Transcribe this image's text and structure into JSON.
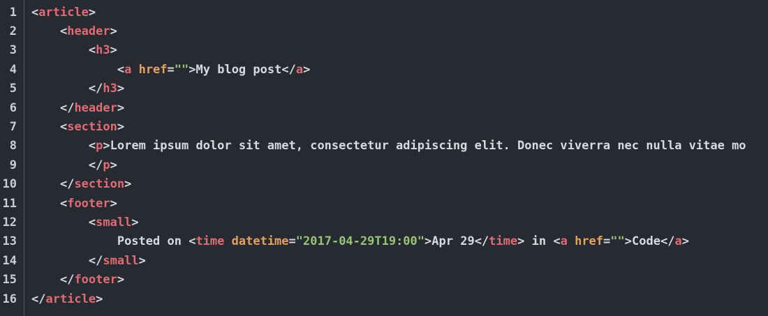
{
  "editor": {
    "colors": {
      "background": "#272a31",
      "tag": "#e06c75",
      "attribute": "#e5a25d",
      "string": "#98c379",
      "text": "#d7dae0",
      "line_number": "#c9ced6"
    },
    "lines": [
      {
        "number": "1",
        "indent": "",
        "tokens": [
          {
            "t": "p",
            "v": "<"
          },
          {
            "t": "tag",
            "v": "article"
          },
          {
            "t": "p",
            "v": ">"
          }
        ]
      },
      {
        "number": "2",
        "indent": "    ",
        "tokens": [
          {
            "t": "p",
            "v": "<"
          },
          {
            "t": "tag",
            "v": "header"
          },
          {
            "t": "p",
            "v": ">"
          }
        ]
      },
      {
        "number": "3",
        "indent": "        ",
        "tokens": [
          {
            "t": "p",
            "v": "<"
          },
          {
            "t": "tag",
            "v": "h3"
          },
          {
            "t": "p",
            "v": ">"
          }
        ]
      },
      {
        "number": "4",
        "indent": "            ",
        "tokens": [
          {
            "t": "p",
            "v": "<"
          },
          {
            "t": "tag",
            "v": "a"
          },
          {
            "t": "p",
            "v": " "
          },
          {
            "t": "attr",
            "v": "href"
          },
          {
            "t": "p",
            "v": "="
          },
          {
            "t": "str",
            "v": "\"\""
          },
          {
            "t": "p",
            "v": ">"
          },
          {
            "t": "txt",
            "v": "My blog post"
          },
          {
            "t": "p",
            "v": "</"
          },
          {
            "t": "tag",
            "v": "a"
          },
          {
            "t": "p",
            "v": ">"
          }
        ]
      },
      {
        "number": "5",
        "indent": "        ",
        "tokens": [
          {
            "t": "p",
            "v": "</"
          },
          {
            "t": "tag",
            "v": "h3"
          },
          {
            "t": "p",
            "v": ">"
          }
        ]
      },
      {
        "number": "6",
        "indent": "    ",
        "tokens": [
          {
            "t": "p",
            "v": "</"
          },
          {
            "t": "tag",
            "v": "header"
          },
          {
            "t": "p",
            "v": ">"
          }
        ]
      },
      {
        "number": "7",
        "indent": "    ",
        "tokens": [
          {
            "t": "p",
            "v": "<"
          },
          {
            "t": "tag",
            "v": "section"
          },
          {
            "t": "p",
            "v": ">"
          }
        ]
      },
      {
        "number": "8",
        "indent": "        ",
        "tokens": [
          {
            "t": "p",
            "v": "<"
          },
          {
            "t": "tag",
            "v": "p"
          },
          {
            "t": "p",
            "v": ">"
          },
          {
            "t": "txt",
            "v": "Lorem ipsum dolor sit amet, consectetur adipiscing elit. Donec viverra nec nulla vitae mo"
          }
        ]
      },
      {
        "number": "9",
        "indent": "        ",
        "tokens": [
          {
            "t": "p",
            "v": "</"
          },
          {
            "t": "tag",
            "v": "p"
          },
          {
            "t": "p",
            "v": ">"
          }
        ]
      },
      {
        "number": "10",
        "indent": "    ",
        "tokens": [
          {
            "t": "p",
            "v": "</"
          },
          {
            "t": "tag",
            "v": "section"
          },
          {
            "t": "p",
            "v": ">"
          }
        ]
      },
      {
        "number": "11",
        "indent": "    ",
        "tokens": [
          {
            "t": "p",
            "v": "<"
          },
          {
            "t": "tag",
            "v": "footer"
          },
          {
            "t": "p",
            "v": ">"
          }
        ]
      },
      {
        "number": "12",
        "indent": "        ",
        "tokens": [
          {
            "t": "p",
            "v": "<"
          },
          {
            "t": "tag",
            "v": "small"
          },
          {
            "t": "p",
            "v": ">"
          }
        ]
      },
      {
        "number": "13",
        "indent": "            ",
        "tokens": [
          {
            "t": "txt",
            "v": "Posted on "
          },
          {
            "t": "p",
            "v": "<"
          },
          {
            "t": "tag",
            "v": "time"
          },
          {
            "t": "p",
            "v": " "
          },
          {
            "t": "attr",
            "v": "datetime"
          },
          {
            "t": "p",
            "v": "="
          },
          {
            "t": "str",
            "v": "\"2017-04-29T19:00\""
          },
          {
            "t": "p",
            "v": ">"
          },
          {
            "t": "txt",
            "v": "Apr 29"
          },
          {
            "t": "p",
            "v": "</"
          },
          {
            "t": "tag",
            "v": "time"
          },
          {
            "t": "p",
            "v": ">"
          },
          {
            "t": "txt",
            "v": " in "
          },
          {
            "t": "p",
            "v": "<"
          },
          {
            "t": "tag",
            "v": "a"
          },
          {
            "t": "p",
            "v": " "
          },
          {
            "t": "attr",
            "v": "href"
          },
          {
            "t": "p",
            "v": "="
          },
          {
            "t": "str",
            "v": "\"\""
          },
          {
            "t": "p",
            "v": ">"
          },
          {
            "t": "txt",
            "v": "Code"
          },
          {
            "t": "p",
            "v": "</"
          },
          {
            "t": "tag",
            "v": "a"
          },
          {
            "t": "p",
            "v": ">"
          }
        ]
      },
      {
        "number": "14",
        "indent": "        ",
        "tokens": [
          {
            "t": "p",
            "v": "</"
          },
          {
            "t": "tag",
            "v": "small"
          },
          {
            "t": "p",
            "v": ">"
          }
        ]
      },
      {
        "number": "15",
        "indent": "    ",
        "tokens": [
          {
            "t": "p",
            "v": "</"
          },
          {
            "t": "tag",
            "v": "footer"
          },
          {
            "t": "p",
            "v": ">"
          }
        ]
      },
      {
        "number": "16",
        "indent": "",
        "tokens": [
          {
            "t": "p",
            "v": "</"
          },
          {
            "t": "tag",
            "v": "article"
          },
          {
            "t": "p",
            "v": ">"
          }
        ]
      }
    ]
  }
}
